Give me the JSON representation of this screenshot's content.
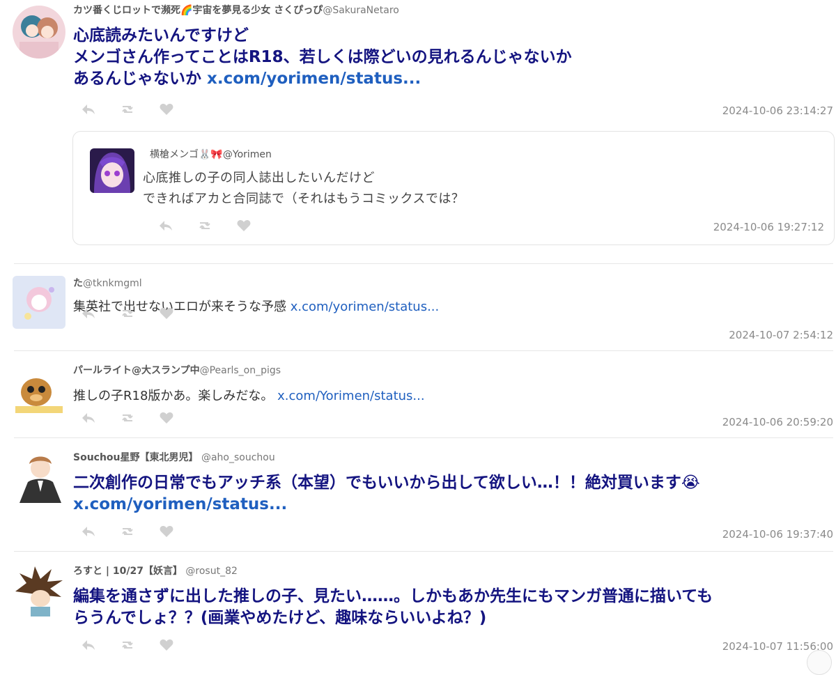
{
  "tweets": [
    {
      "name": "カツ番くじロットで瀕死🌈宇宙を夢見る少女 さくぴっぴ",
      "handle": "@SakuraNetaro",
      "line1": "心底読みたいんですけど",
      "line2": "メンゴさん作ってことはR18、若しくは際どいの見れるんじゃないか",
      "line3": "あるんじゃないか ",
      "link": "x.com/yorimen/status...",
      "time": "2024-10-06 23:14:27",
      "quote": {
        "name": "横槍メンゴ🐰🎀",
        "handle": "@Yorimen",
        "line1": "心底推しの子の同人誌出したいんだけど",
        "line2": "できればアカと合同誌で（それはもうコミックスでは？",
        "time": "2024-10-06 19:27:12"
      }
    },
    {
      "name": "た",
      "handle": "@tknkmgml",
      "text": "集英社で出せないエロが来そうな予感 ",
      "link": "x.com/yorimen/status...",
      "time": "2024-10-07 2:54:12"
    },
    {
      "name": "パールライト@大スランプ中",
      "handle": "@Pearls_on_pigs",
      "text": "推しの子R18版かあ。楽しみだな。 ",
      "link": "x.com/Yorimen/status...",
      "time": "2024-10-06 20:59:20"
    },
    {
      "name": "Souchou星野【東北男児】",
      "handle": " @aho_souchou",
      "line1": "二次創作の日常でもアッチ系（本望）でもいいから出して欲しい…！！絶対買います😭",
      "link": "x.com/yorimen/status...",
      "time": "2024-10-06 19:37:40"
    },
    {
      "name": "ろすと | 10/27【妖言】",
      "handle": " @rosut_82",
      "line1": "編集を通さずに出した推しの子、見たい……。しかもあか先生にもマンガ普通に描いても",
      "line2": "らうんでしょ？？(画業やめたけど、趣味ならいいよね？)",
      "time": "2024-10-07 11:56:00"
    }
  ],
  "colors": {
    "accent_text": "#141480",
    "link": "#1f5fbf",
    "meta": "#8a8a8a"
  },
  "icons": [
    "reply-icon",
    "retweet-icon",
    "like-icon"
  ]
}
